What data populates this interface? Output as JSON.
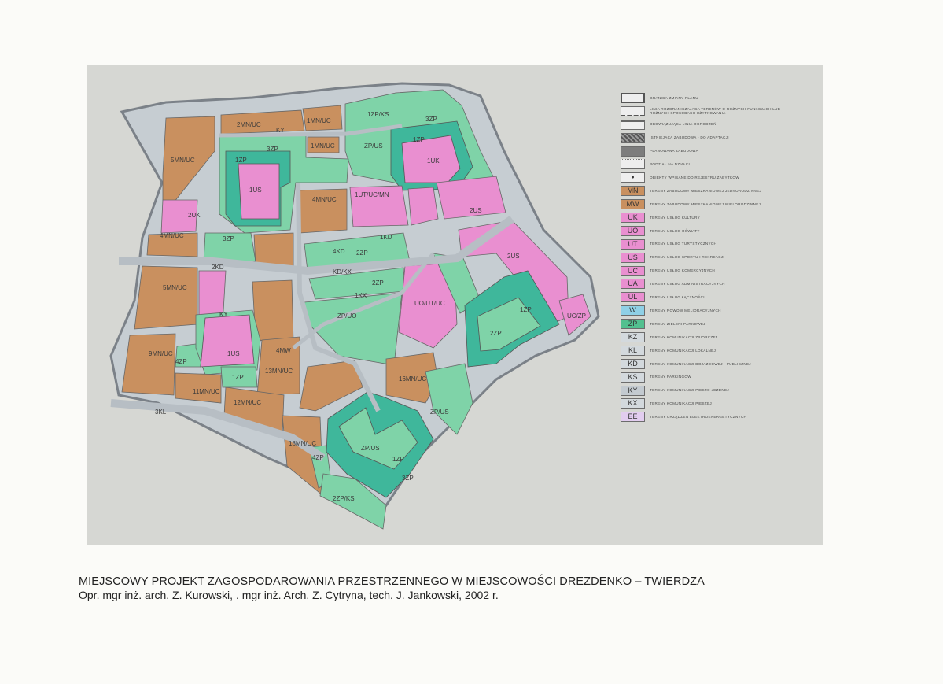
{
  "caption": {
    "title": "MIEJSCOWY PROJEKT ZAGOSPODAROWANIA PRZESTRZENNEGO W MIEJSCOWOŚCI DREZDENKO – TWIERDZA",
    "authors": "Opr. mgr inż. arch. Z. Kurowski, . mgr inż. Arch. Z. Cytryna, tech. J. Jankowski, 2002 r."
  },
  "colors": {
    "MN": "#c9905f",
    "MW": "#c9905f",
    "UK": "#e98fd0",
    "UO": "#e98fd0",
    "UT": "#e98fd0",
    "US": "#e98fd0",
    "UC": "#e98fd0",
    "UA": "#e98fd0",
    "UL": "#e98fd0",
    "W": "#8fd0e6",
    "ZP": "#7fd3a8",
    "ZP_dark": "#3fb79b",
    "road": "#c6cdd2",
    "board": "#d6d7d3"
  },
  "legend": [
    {
      "code": "",
      "icon": "plan-boundary-icon",
      "text": "GRANICA ZMIANY PLANU"
    },
    {
      "code": "",
      "icon": "division-line-icon",
      "text": "LINIA ROZGRANICZAJĄCA TERENÓW O RÓŻNYCH FUNKCJACH LUB RÓŻNYCH SPOSOBACH UŻYTKOWANIA"
    },
    {
      "code": "",
      "icon": "building-line-icon",
      "text": "OBOWIĄZUJĄCA LINIA OGRODZEŃ"
    },
    {
      "code": "",
      "icon": "existing-building-icon",
      "text": "ISTNIEJĄCA ZABUDOWA - DO ADAPTACJI"
    },
    {
      "code": "",
      "icon": "planned-building-icon",
      "text": "PLANOWANA ZABUDOWA"
    },
    {
      "code": "",
      "icon": "parcel-division-icon",
      "text": "PODZIAŁ NA DZIAŁKI"
    },
    {
      "code": "",
      "icon": "monument-dot-icon",
      "text": "OBIEKTY WPISANE DO REJESTRU ZABYTKÓW"
    },
    {
      "code": "MN",
      "color": "#c9905f",
      "text": "TERENY ZABUDOWY MIESZKANIOWEJ JEDNORODZINNEJ"
    },
    {
      "code": "MW",
      "color": "#c9905f",
      "text": "TERENY ZABUDOWY MIESZKANIOWEJ WIELORODZINNEJ"
    },
    {
      "code": "UK",
      "color": "#e98fd0",
      "text": "TERENY USŁUG KULTURY"
    },
    {
      "code": "UO",
      "color": "#e98fd0",
      "text": "TERENY USŁUG OŚWIATY"
    },
    {
      "code": "UT",
      "color": "#e98fd0",
      "text": "TERENY USŁUG TURYSTYCZNYCH"
    },
    {
      "code": "US",
      "color": "#e98fd0",
      "text": "TERENY USŁUG SPORTU I REKREACJI"
    },
    {
      "code": "UC",
      "color": "#e98fd0",
      "text": "TERENY USŁUG KOMERCYJNYCH"
    },
    {
      "code": "UA",
      "color": "#e98fd0",
      "text": "TERENY USŁUG ADMINISTRACYJNYCH"
    },
    {
      "code": "UL",
      "color": "#e98fd0",
      "text": "TERENY USŁUG ŁĄCZNOŚCI"
    },
    {
      "code": "W",
      "color": "#8fd0e6",
      "text": "TERENY ROWÓW MELIORACYJNYCH"
    },
    {
      "code": "ZP",
      "color": "#52c08f",
      "text": "TERENY ZIELENI PARKOWEJ"
    },
    {
      "code": "KZ",
      "color": "#d3d9dd",
      "text": "TERENY KOMUNIKACJI ZBIORCZEJ"
    },
    {
      "code": "KL",
      "color": "#d3d9dd",
      "text": "TERENY KOMUNIKACJI LOKALNEJ"
    },
    {
      "code": "KD",
      "color": "#d3d9dd",
      "text": "TERENY KOMUNIKACJI DOJAZDOWEJ - PUBLICZNEJ"
    },
    {
      "code": "KS",
      "color": "#d3d9dd",
      "text": "TERENY PARKINGÓW"
    },
    {
      "code": "KY",
      "color": "#c3cad0",
      "text": "TERENY KOMUNIKACJI PIESZO-JEZDNEJ"
    },
    {
      "code": "KX",
      "color": "#d3d9dd",
      "text": "TERENY KOMUNIKACJI PIESZEJ"
    },
    {
      "code": "EE",
      "color": "#e2cdef",
      "text": "TERENY URZĄDZEŃ ELEKTROENERGETYCZNYCH"
    }
  ],
  "map_labels": [
    {
      "id": "2MN/UC",
      "text": "2MN/UC"
    },
    {
      "id": "1MN/UC",
      "text": "1MN/UC"
    },
    {
      "id": "1ZP/KS",
      "text": "1ZP/KS"
    },
    {
      "id": "3ZP-n",
      "text": "3ZP"
    },
    {
      "id": "1MN/UC-b",
      "text": "1MN/UC"
    },
    {
      "id": "ZP/US-n",
      "text": "ZP/US"
    },
    {
      "id": "1ZP-ne",
      "text": "1ZP"
    },
    {
      "id": "1UK",
      "text": "1UK"
    },
    {
      "id": "3ZP-w",
      "text": "3ZP"
    },
    {
      "id": "1ZP-w",
      "text": "1ZP"
    },
    {
      "id": "1US-n",
      "text": "1US"
    },
    {
      "id": "5MN/UC",
      "text": "5MN/UC"
    },
    {
      "id": "2UK",
      "text": "2UK"
    },
    {
      "id": "4MN/UC",
      "text": "4MN/UC"
    },
    {
      "id": "1UT/UC/MN",
      "text": "1UT/UC/MN"
    },
    {
      "id": "4MN/UC-c",
      "text": "4MN/UC"
    },
    {
      "id": "2US-e",
      "text": "2US"
    },
    {
      "id": "2US",
      "text": "2US"
    },
    {
      "id": "3ZP-c",
      "text": "3ZP"
    },
    {
      "id": "4KD",
      "text": "4KD"
    },
    {
      "id": "2ZP",
      "text": "2ZP"
    },
    {
      "id": "KD/KX",
      "text": "KD/KX"
    },
    {
      "id": "2ZP-b",
      "text": "2ZP"
    },
    {
      "id": "1KX",
      "text": "1KX"
    },
    {
      "id": "ZP/UO",
      "text": "ZP/UO"
    },
    {
      "id": "UO/UT/UC",
      "text": "UO/UT/UC"
    },
    {
      "id": "5MN/UC-w",
      "text": "5MN/UC"
    },
    {
      "id": "1US-s",
      "text": "1US"
    },
    {
      "id": "4MW",
      "text": "4MW"
    },
    {
      "id": "1ZP-e",
      "text": "1ZP"
    },
    {
      "id": "2ZP-e",
      "text": "2ZP"
    },
    {
      "id": "UC/ZP",
      "text": "UC/ZP"
    },
    {
      "id": "9MN/UC",
      "text": "9MN/UC"
    },
    {
      "id": "4ZP",
      "text": "4ZP"
    },
    {
      "id": "13MN/UC",
      "text": "13MN/UC"
    },
    {
      "id": "1ZP-s",
      "text": "1ZP"
    },
    {
      "id": "11MN/UC",
      "text": "11MN/UC"
    },
    {
      "id": "12MN/UC",
      "text": "12MN/UC"
    },
    {
      "id": "16MN/UC",
      "text": "16MN/UC"
    },
    {
      "id": "ZP/US-s",
      "text": "ZP/US"
    },
    {
      "id": "18MN/UC",
      "text": "18MN/UC"
    },
    {
      "id": "ZP/US-c",
      "text": "ZP/US"
    },
    {
      "id": "1ZP-c",
      "text": "1ZP"
    },
    {
      "id": "3ZP-s",
      "text": "3ZP"
    },
    {
      "id": "4ZP-s",
      "text": "4ZP"
    },
    {
      "id": "2ZP/KS",
      "text": "2ZP/KS"
    },
    {
      "id": "1KD",
      "text": "1KD"
    },
    {
      "id": "2KD",
      "text": "2KD"
    },
    {
      "id": "3KL",
      "text": "3KL"
    },
    {
      "id": "KY-n",
      "text": "KY"
    },
    {
      "id": "KY-w",
      "text": "KY"
    }
  ]
}
